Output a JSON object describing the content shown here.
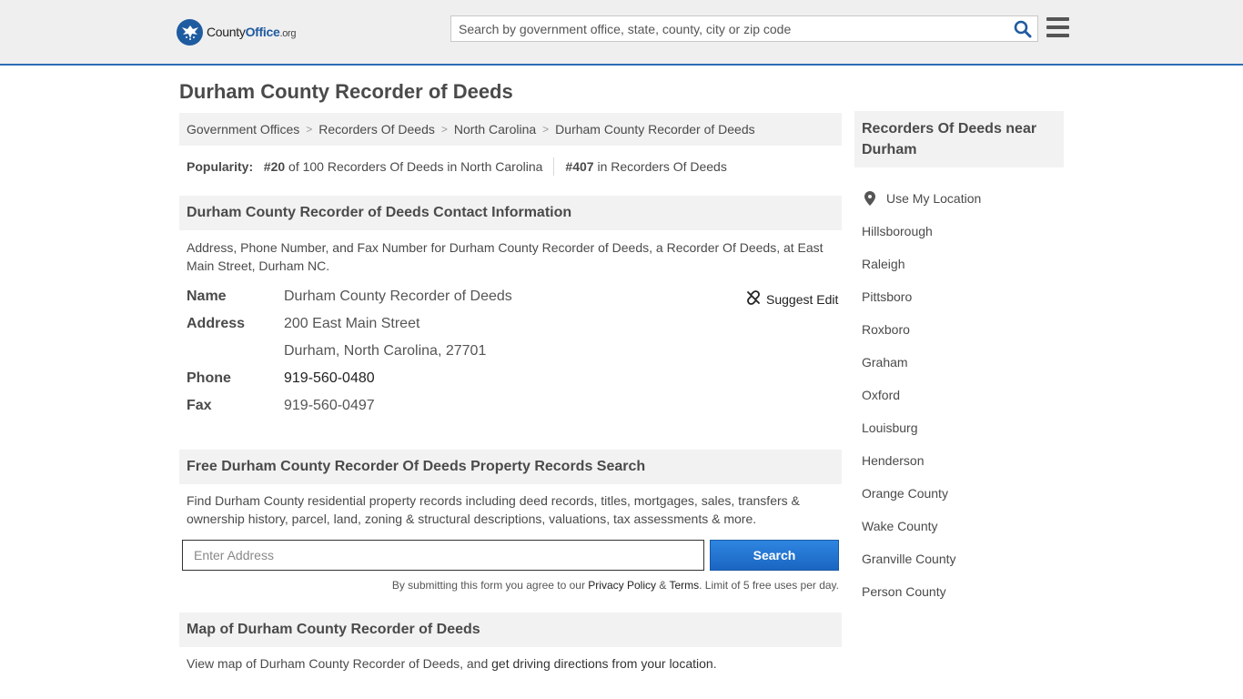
{
  "header": {
    "logo_main": "County",
    "logo_office": "Office",
    "logo_tld": ".org",
    "search_placeholder": "Search by government office, state, county, city or zip code"
  },
  "page_title": "Durham County Recorder of Deeds",
  "breadcrumb": [
    "Government Offices",
    "Recorders Of Deeds",
    "North Carolina",
    "Durham County Recorder of Deeds"
  ],
  "popularity": {
    "label": "Popularity:",
    "rank_state": "#20",
    "rank_state_text": "of 100 Recorders Of Deeds in North Carolina",
    "rank_national": "#407",
    "rank_national_text": "in Recorders Of Deeds"
  },
  "contact": {
    "heading": "Durham County Recorder of Deeds Contact Information",
    "description": "Address, Phone Number, and Fax Number for Durham County Recorder of Deeds, a Recorder Of Deeds, at East Main Street, Durham NC.",
    "suggest_edit": "Suggest Edit",
    "name_label": "Name",
    "name": "Durham County Recorder of Deeds",
    "address_label": "Address",
    "address_line1": "200 East Main Street",
    "address_line2": "Durham, North Carolina, 27701",
    "phone_label": "Phone",
    "phone": "919-560-0480",
    "fax_label": "Fax",
    "fax": "919-560-0497"
  },
  "property_search": {
    "heading": "Free Durham County Recorder Of Deeds Property Records Search",
    "description": "Find Durham County residential property records including deed records, titles, mortgages, sales, transfers & ownership history, parcel, land, zoning & structural descriptions, valuations, tax assessments & more.",
    "input_placeholder": "Enter Address",
    "button_label": "Search",
    "disclaimer_prefix": "By submitting this form you agree to our",
    "privacy_link": "Privacy Policy",
    "amp": "&",
    "terms_link": "Terms",
    "disclaimer_suffix": ". Limit of 5 free uses per day."
  },
  "map": {
    "heading": "Map of Durham County Recorder of Deeds",
    "description_prefix": "View map of Durham County Recorder of Deeds, and",
    "directions_link": "get driving directions from your location",
    "description_suffix": "."
  },
  "sidebar": {
    "heading": "Recorders Of Deeds near Durham",
    "use_location": "Use My Location",
    "items": [
      "Hillsborough",
      "Raleigh",
      "Pittsboro",
      "Roxboro",
      "Graham",
      "Oxford",
      "Louisburg",
      "Henderson",
      "Orange County",
      "Wake County",
      "Granville County",
      "Person County"
    ]
  },
  "colors": {
    "brand_blue": "#1f5ba0",
    "header_border": "#2a6db5",
    "button_blue": "#1a66c2"
  }
}
